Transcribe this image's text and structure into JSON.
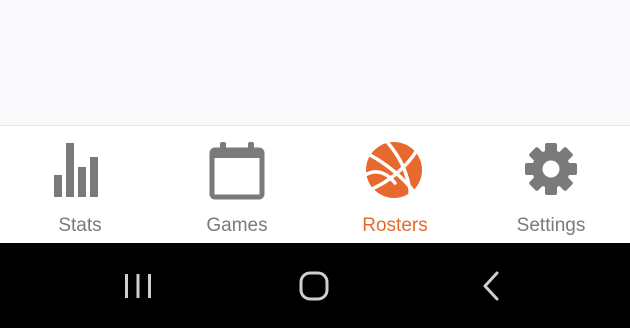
{
  "colors": {
    "accent": "#e8692e",
    "inactive": "#7a7a7a",
    "nav_background": "#000000",
    "nav_icon": "#cfcfcf"
  },
  "tab_bar": {
    "tabs": [
      {
        "label": "Stats",
        "icon": "bar-chart-icon",
        "active": false
      },
      {
        "label": "Games",
        "icon": "calendar-icon",
        "active": false
      },
      {
        "label": "Rosters",
        "icon": "basketball-icon",
        "active": true
      },
      {
        "label": "Settings",
        "icon": "gear-icon",
        "active": false
      }
    ]
  },
  "system_nav": {
    "buttons": [
      {
        "icon": "recents-icon"
      },
      {
        "icon": "home-icon"
      },
      {
        "icon": "back-icon"
      }
    ]
  }
}
